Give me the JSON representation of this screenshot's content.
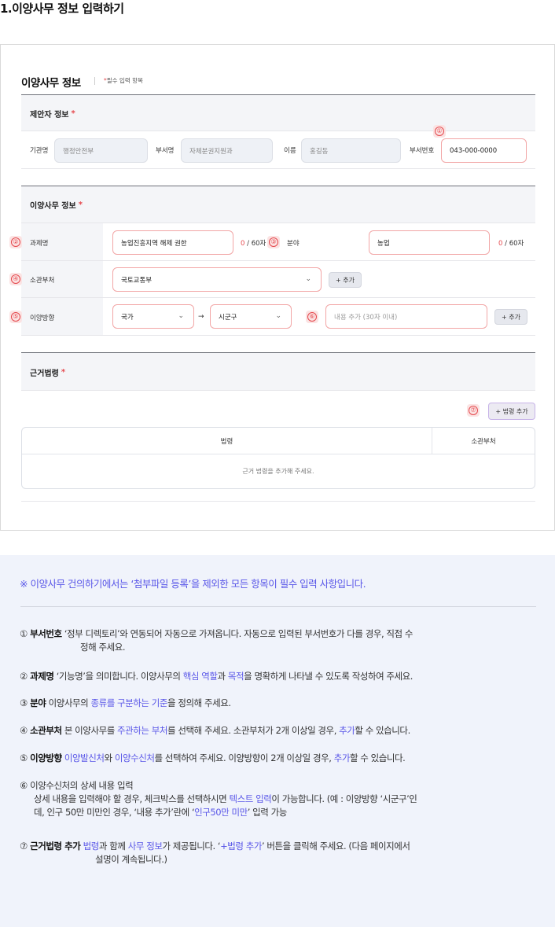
{
  "page_heading": "1.이양사무 정보 입력하기",
  "form": {
    "title": "이양사무 정보",
    "required_note": "필수 입력 항목",
    "required_star": "*",
    "proposer": {
      "header": "제안자 정보",
      "agency_label": "기관명",
      "agency_value": "행정안전부",
      "dept_label": "부서명",
      "dept_value": "자체분권지원과",
      "name_label": "이름",
      "name_value": "홍길동",
      "phone_label": "부서번호",
      "phone_value": "043-000-0000"
    },
    "transfer": {
      "header": "이양사무 정보",
      "task_label": "과제명",
      "task_value": "농업진흥지역 해제 권한",
      "task_count": "0",
      "task_max": " / 60자",
      "field_label": "분야",
      "field_value": "농업",
      "field_count": "0",
      "field_max": " / 60자",
      "ministry_label": "소관부처",
      "ministry_value": "국토교통부",
      "ministry_add": "+ 추가",
      "direction_label": "이양방향",
      "direction_from": "국가",
      "direction_arrow": "→",
      "direction_to": "시군구",
      "detail_placeholder": "내용 추가 (30자 이내)",
      "direction_add": "+ 추가"
    },
    "law": {
      "header": "근거법령",
      "add_button": "+ 법령 추가",
      "col_law": "법령",
      "col_ministry": "소관부처",
      "empty_text": "근거 법령을 추가해 주세요."
    },
    "badges": [
      "①",
      "②",
      "③",
      "④",
      "⑤",
      "⑥",
      "⑦"
    ]
  },
  "explain": {
    "notice": "※ 이양사무 건의하기에서는 ‘첨부파일 등록’을 제외한  모든 항목이 필수 입력 사항입니다.",
    "item1_num": "①",
    "item1_title": "부서번호",
    "item1_text_a": "‘정부 디렉토리’와 연동되어 자동으로 가져옵니다.  자동으로 입력된 부서번호가 다를 경우, 직접 수",
    "item1_text_b": "정해 주세요.",
    "item2_num": "②",
    "item2_title": "과제명",
    "item2_text_a": "‘기능명’을 의미합니다. 이양사무의 ",
    "item2_hi_a": "핵심 역할",
    "item2_text_b": "과 ",
    "item2_hi_b": "목적",
    "item2_text_c": "을 명확하게 나타낼 수 있도록 작성하여 주세요.",
    "item3_num": "③",
    "item3_title": "분야",
    "item3_text_a": "이양사무의 ",
    "item3_hi": "종류를 구분하는 기준",
    "item3_text_b": "을 정의해 주세요.",
    "item4_num": "④",
    "item4_title": "소관부처",
    "item4_text_a": "본 이양사무를 ",
    "item4_hi_a": "주관하는 부처",
    "item4_text_b": "를 선택해 주세요. 소관부처가 2개 이상일 경우, ",
    "item4_hi_b": "추가",
    "item4_text_c": "할 수 있습니다.",
    "item5_num": "⑤",
    "item5_title": "이양방향",
    "item5_hi_a": "이양발신처",
    "item5_text_a": "와 ",
    "item5_hi_b": "이양수신처",
    "item5_text_b": "를 선택하여 주세요. 이양방향이 2개 이상일 경우, ",
    "item5_hi_c": "추가",
    "item5_text_c": "할 수 있습니다.",
    "item6_num": "⑥",
    "item6_title": "이양수신처의 상세 내용 입력",
    "item6_text_a": "상세 내용을 입력해야 할 경우, 체크박스를 선택하시면 ",
    "item6_hi_a": "텍스트 입력",
    "item6_text_b": "이 가능합니다.  (예 : 이양방향 ‘시군구’인",
    "item6_text_c": "데, 인구 50만 미만인 경우, ‘내용 추가’란에 ‘",
    "item6_hi_b": "인구50만 미만",
    "item6_text_d": "’ 입력 가능",
    "item7_num": "⑦",
    "item7_title": "근거법령 추가",
    "item7_hi_a": "법령",
    "item7_text_a": "과 함께 ",
    "item7_hi_b": "사무 정보",
    "item7_text_b": "가 제공됩니다. ‘",
    "item7_hi_c": "+법령 추가",
    "item7_text_c": "’ 버튼을 클릭해 주세요. (다음 페이지에서",
    "item7_text_d": "설명이 계속됩니다.)"
  },
  "colors": {
    "accent": "#5a57e8",
    "required": "#e5484d",
    "header_bg": "#f4f5f8",
    "panel_bg": "#f0f3fb"
  }
}
